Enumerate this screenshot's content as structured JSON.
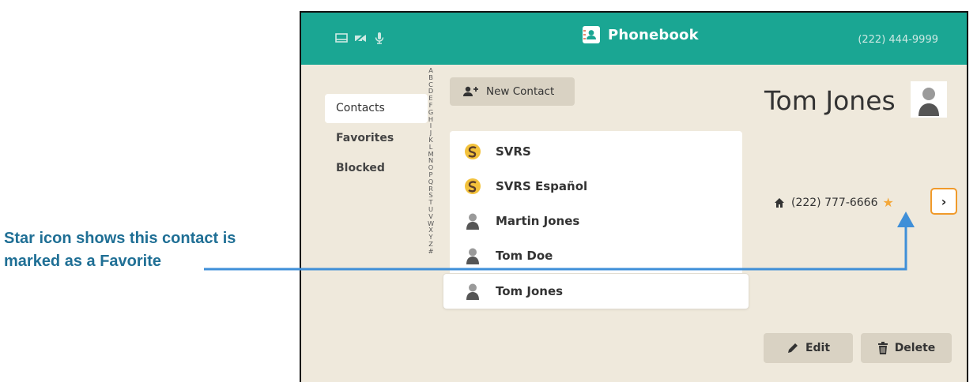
{
  "annotation": {
    "line1": "Star icon shows this contact is",
    "line2": "marked as a Favorite"
  },
  "header": {
    "title": "Phonebook",
    "phone": "(222) 444-9999"
  },
  "nav": {
    "items": [
      {
        "label": "Contacts",
        "active": true
      },
      {
        "label": "Favorites",
        "active": false
      },
      {
        "label": "Blocked",
        "active": false
      }
    ]
  },
  "alphabet": [
    "A",
    "B",
    "C",
    "D",
    "E",
    "F",
    "G",
    "H",
    "I",
    "J",
    "K",
    "L",
    "M",
    "N",
    "O",
    "P",
    "Q",
    "R",
    "S",
    "T",
    "U",
    "V",
    "W",
    "X",
    "Y",
    "Z",
    "#"
  ],
  "new_contact_label": "New Contact",
  "contacts": [
    {
      "name": "SVRS",
      "icon": "svrs-logo-icon"
    },
    {
      "name": "SVRS Español",
      "icon": "svrs-logo-icon"
    },
    {
      "name": "Martin Jones",
      "icon": "person-avatar-icon"
    },
    {
      "name": "Tom Doe",
      "icon": "person-avatar-icon"
    },
    {
      "name": "Tom Jones",
      "icon": "person-avatar-icon",
      "selected": true
    }
  ],
  "detail": {
    "name": "Tom Jones",
    "phone": "(222) 777-6666",
    "phone_type_icon": "home-icon",
    "favorite": true,
    "edit_label": "Edit",
    "delete_label": "Delete"
  },
  "colors": {
    "header_bg": "#1aa693",
    "screen_bg": "#efe9dc",
    "star": "#f4a83a",
    "annotation_text": "#1f6f95",
    "callout_line": "#3f8fd8"
  }
}
